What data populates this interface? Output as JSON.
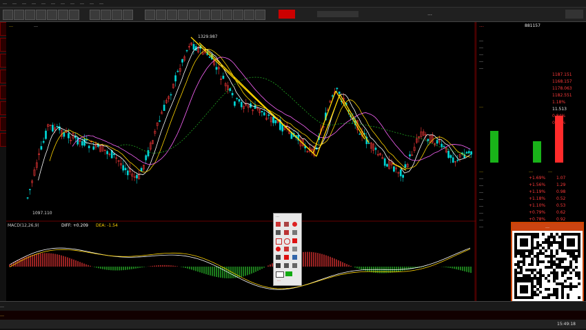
{
  "menu": [
    "…",
    "…",
    "…",
    "…",
    "…",
    "…",
    "…",
    "…",
    "…",
    "…",
    "…"
  ],
  "window_title": "…",
  "stock": {
    "name": "…",
    "code": "881157"
  },
  "chart_header": {
    "ma_label": "…"
  },
  "price_labels": {
    "high": "1329.987",
    "low": "1097.110"
  },
  "macd_header": {
    "name": "MACD(12,26,9)",
    "diff": "DIFF: +0.209",
    "dea": "DEA: -1.54"
  },
  "right_panel": {
    "title": "…",
    "code": "881157",
    "quote_rows": [
      "…",
      "…",
      "…",
      "…",
      "…",
      "…",
      "…",
      "…",
      "…",
      "…"
    ],
    "values": [
      "1187.151",
      "1168.157",
      "1178.063",
      "1182.551",
      "1.18%",
      "11.513",
      "0.84%",
      "0.88%"
    ],
    "flow_title": "…",
    "sector_header": [
      "…",
      "…",
      "…"
    ],
    "sectors": [
      {
        "name": "…",
        "chg": "+1.69%",
        "val": "1.07"
      },
      {
        "name": "…",
        "chg": "+1.56%",
        "val": "1.29"
      },
      {
        "name": "…",
        "chg": "+1.19%",
        "val": "0.98"
      },
      {
        "name": "…",
        "chg": "+1.18%",
        "val": "0.52"
      },
      {
        "name": "…",
        "chg": "+1.10%",
        "val": "0.53"
      },
      {
        "name": "…",
        "chg": "+0.79%",
        "val": "0.62"
      },
      {
        "name": "…",
        "chg": "+0.78%",
        "val": "0.92"
      },
      {
        "name": "…",
        "chg": "+0.78%",
        "val": "0.96"
      }
    ]
  },
  "qr_caption": "…",
  "tools_caption": "…",
  "tools_footer": "…",
  "status": {
    "row1": "…",
    "row2": "…",
    "clock": "15:49:18"
  },
  "colors": {
    "up": "#ff3a3a",
    "down": "#00d4d4",
    "bg": "#000000",
    "ma5": "#ffffff",
    "ma10": "#ffd400",
    "ma20": "#ff66ff",
    "ma60": "#22aa22"
  }
}
